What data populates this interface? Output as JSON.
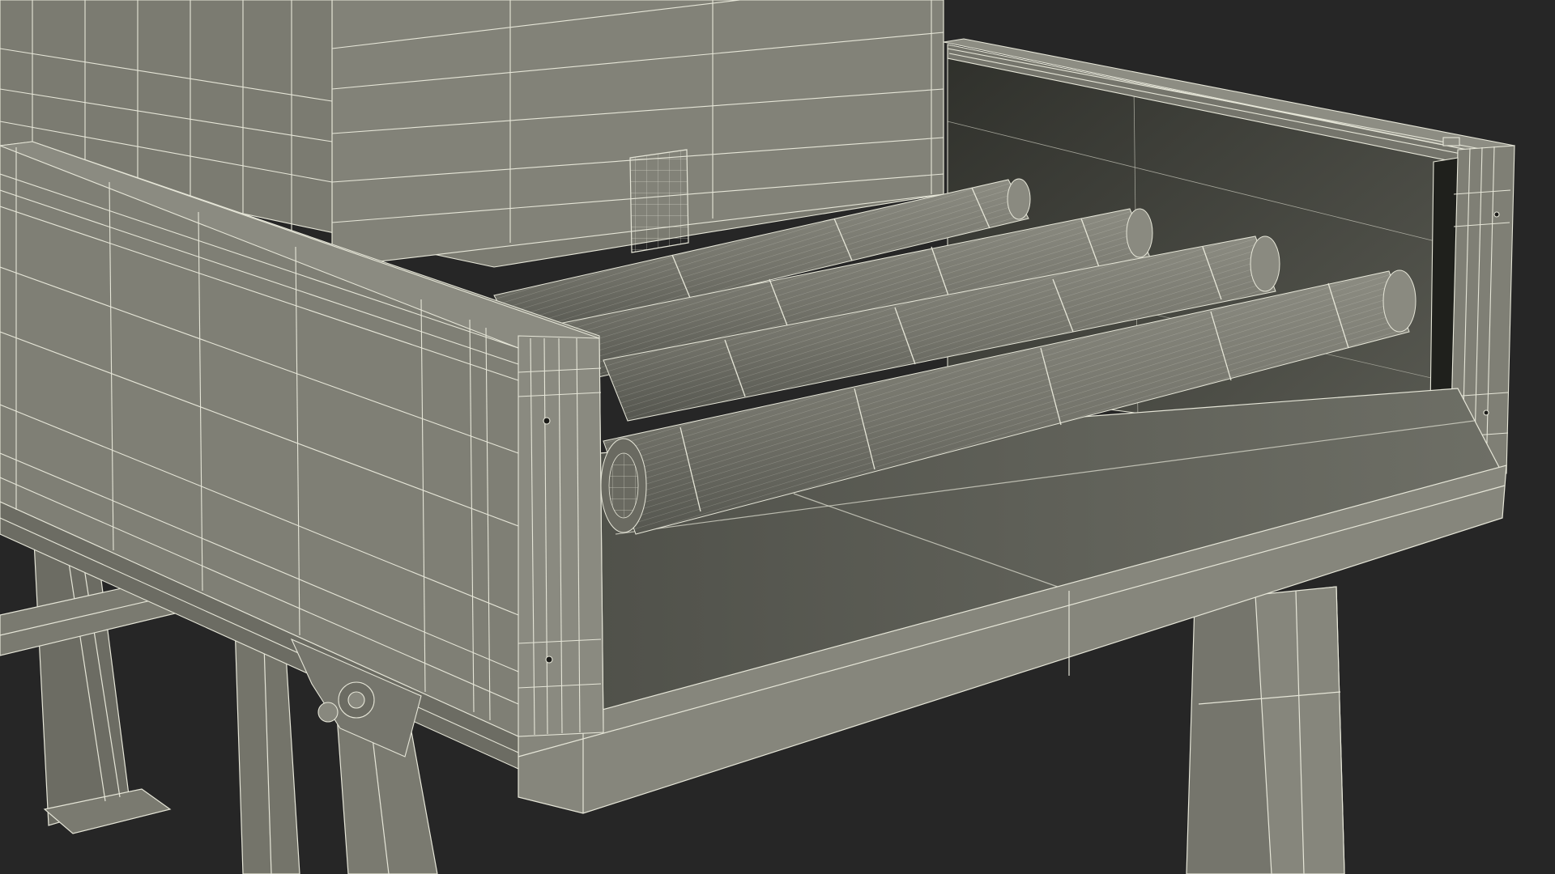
{
  "scene": {
    "background_color": "#262626",
    "surface_color": "#7a7a70",
    "surface_dark_color": "#5f5f57",
    "surface_light_color": "#8a8a80",
    "wire_color": "#e6e6d8",
    "interior_color": "#3a3b35"
  }
}
